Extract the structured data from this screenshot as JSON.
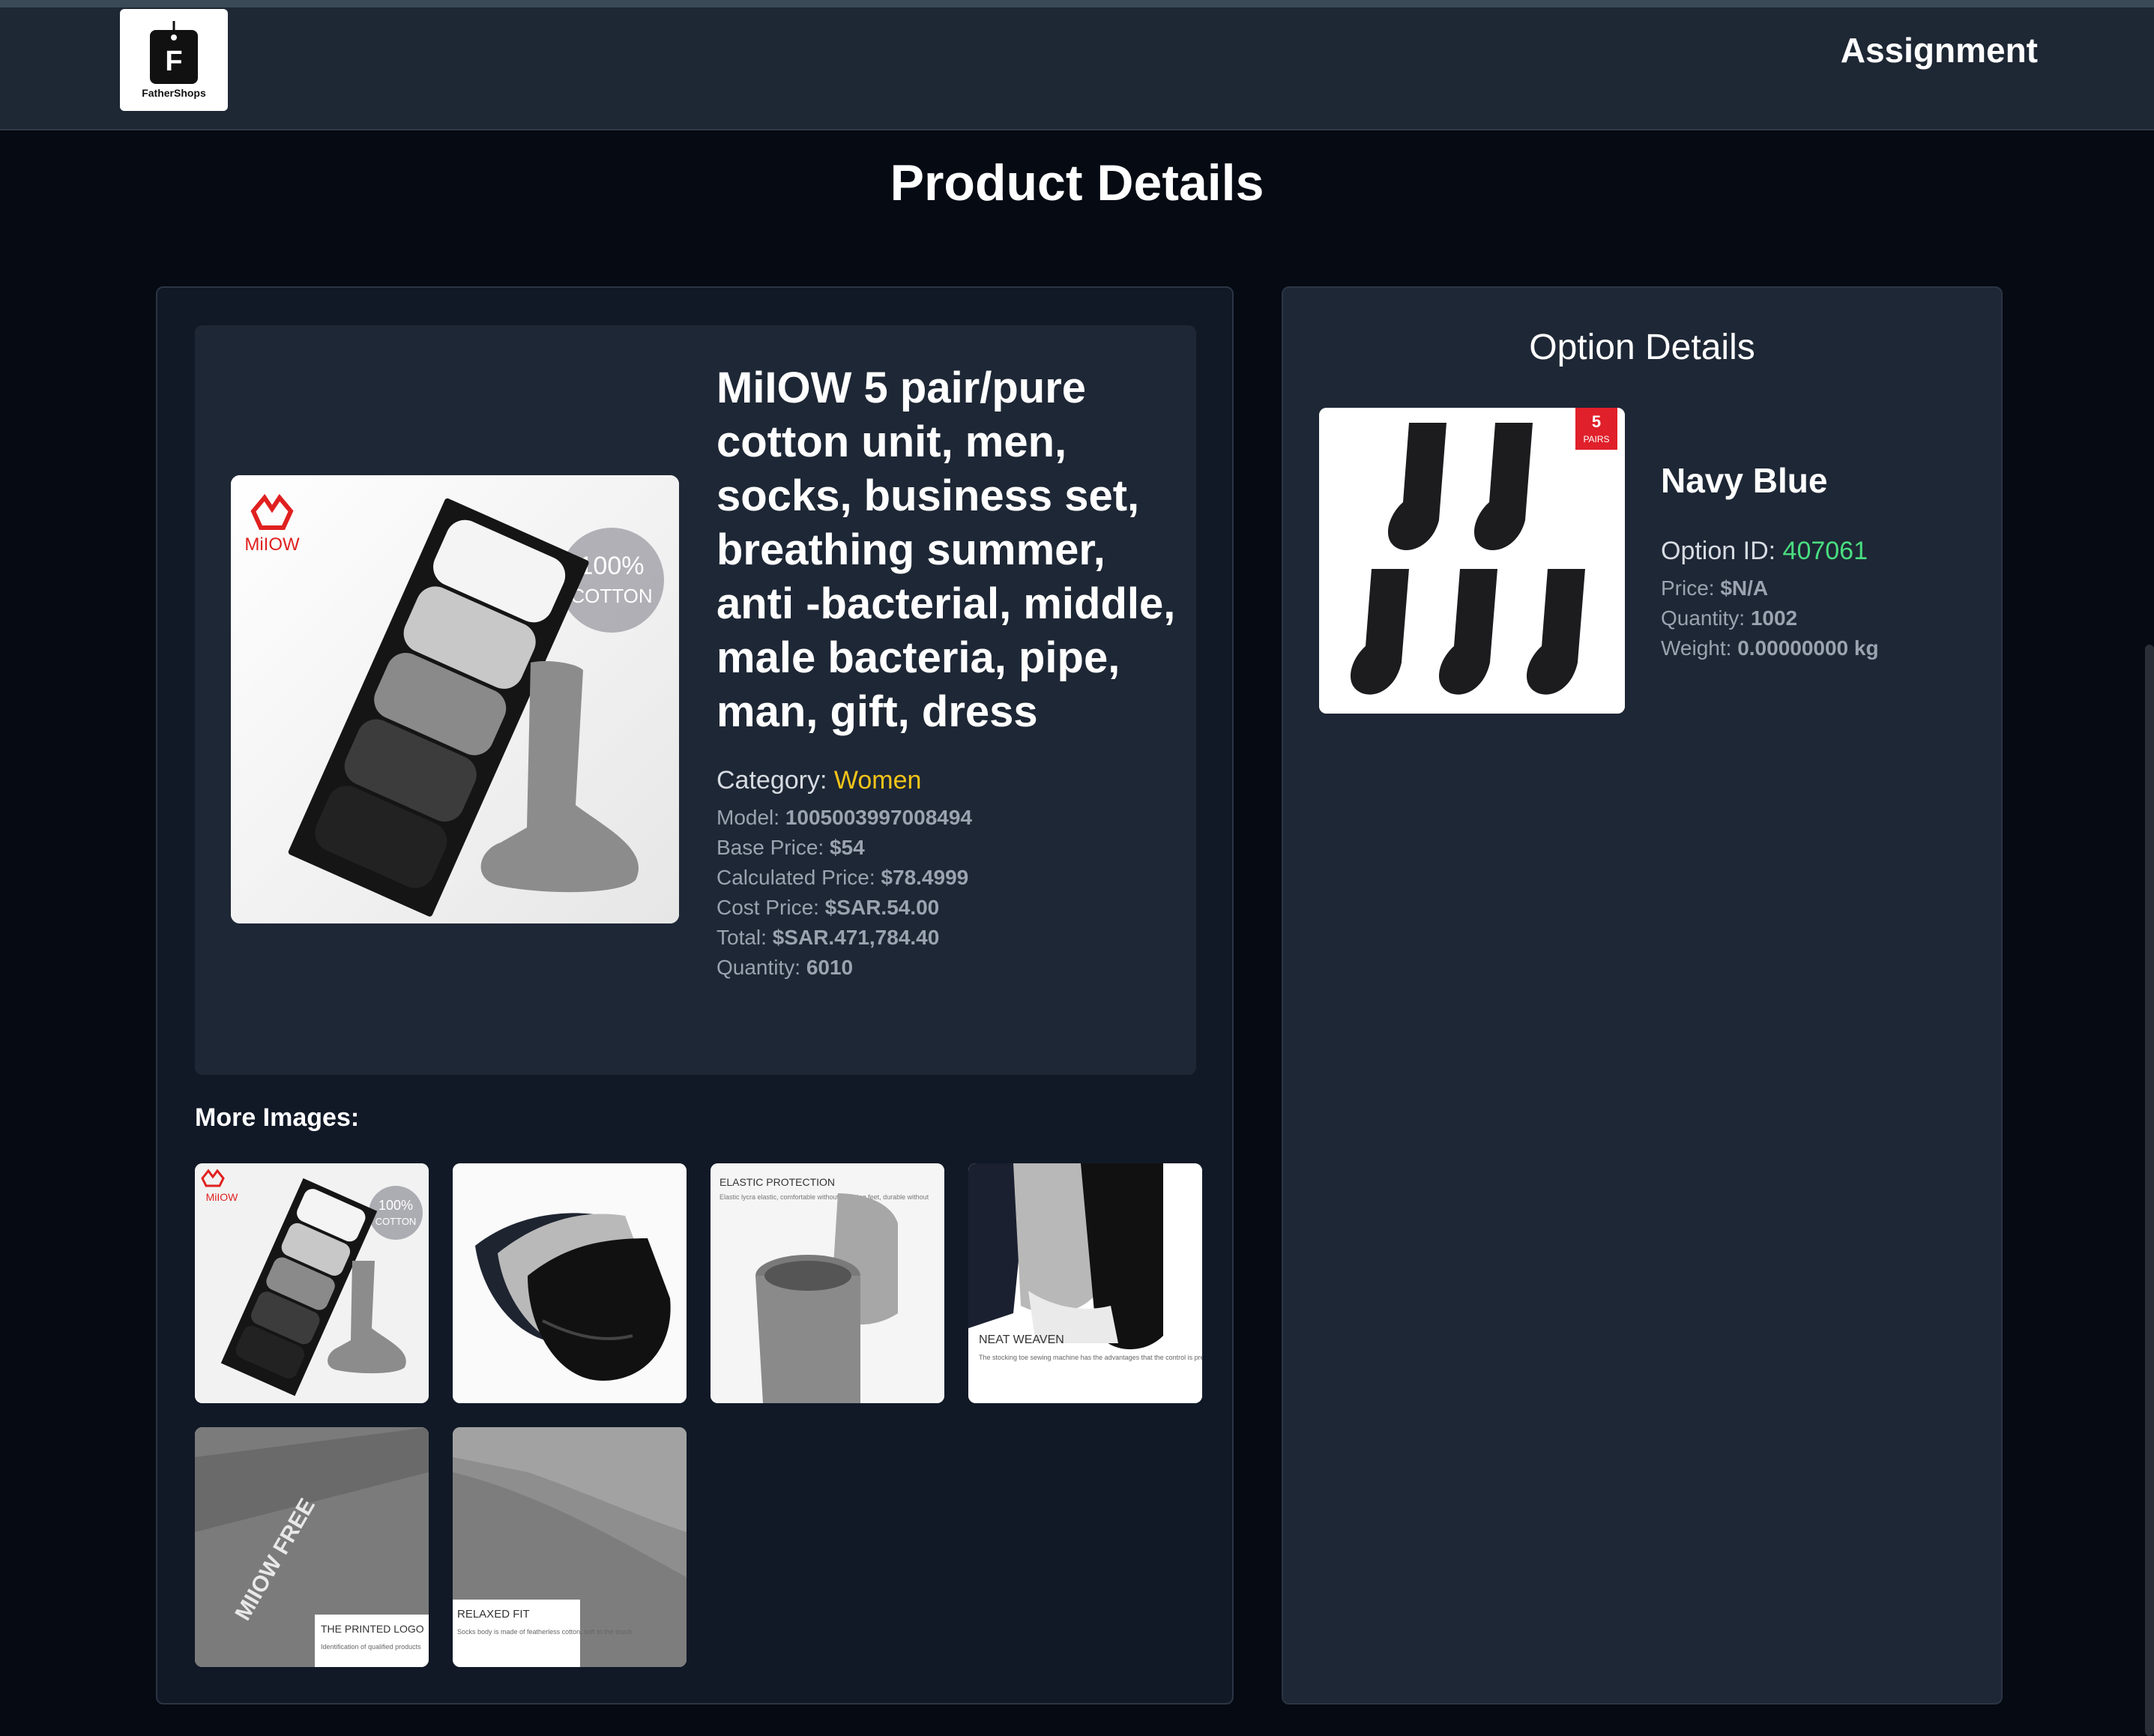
{
  "header": {
    "logo_text": "FatherShops",
    "logo_letter": "F",
    "nav_title": "Assignment"
  },
  "page": {
    "title": "Product Details"
  },
  "product": {
    "name": "MiIOW 5 pair/pure cotton unit, men, socks, business set, breathing summer, anti -bacterial, middle, male bacteria, pipe, man, gift, dress",
    "category_label": "Category:",
    "category_value": "Women",
    "model_label": "Model:",
    "model_value": "1005003997008494",
    "base_price_label": "Base Price:",
    "base_price_value": "$54",
    "calculated_price_label": "Calculated Price:",
    "calculated_price_value": "$78.4999",
    "cost_price_label": "Cost Price:",
    "cost_price_value": "$SAR.54.00",
    "total_label": "Total:",
    "total_value": "$SAR.471,784.40",
    "quantity_label": "Quantity:",
    "quantity_value": "6010",
    "main_image_brand": "MiIOW",
    "main_image_badge_line1": "100%",
    "main_image_badge_line2": "COTTON"
  },
  "more_images": {
    "label": "More Images:",
    "thumbs": [
      {
        "brand": "MiIOW",
        "badge1": "100%",
        "badge2": "COTTON"
      },
      {
        "caption": ""
      },
      {
        "caption": "ELASTIC PROTECTION",
        "sub": "Elastic lycra elastic, comfortable without straining feet, durable without"
      },
      {
        "caption": "NEAT WEAVEN",
        "sub": "The stocking toe sewing machine has the advantages that the control is precise and the stocking toe seam is neat."
      },
      {
        "caption": "THE PRINTED LOGO",
        "sub": "Identification of qualified products",
        "print": "MIIOW FREE"
      },
      {
        "caption": "RELAXED FIT",
        "sub": "Socks body is made of featherless cotton, soft to the touch"
      }
    ]
  },
  "option": {
    "title": "Option Details",
    "name": "Navy Blue",
    "id_label": "Option ID:",
    "id_value": "407061",
    "price_label": "Price:",
    "price_value": "$N/A",
    "quantity_label": "Quantity:",
    "quantity_value": "1002",
    "weight_label": "Weight:",
    "weight_value": "0.00000000 kg",
    "badge_num": "5",
    "badge_text": "PAIRS"
  },
  "colors": {
    "background": "#050a13",
    "navbar": "#1e2734",
    "panel": "#1e2735",
    "category_accent": "#f5c518",
    "option_id_accent": "#4ade80"
  }
}
